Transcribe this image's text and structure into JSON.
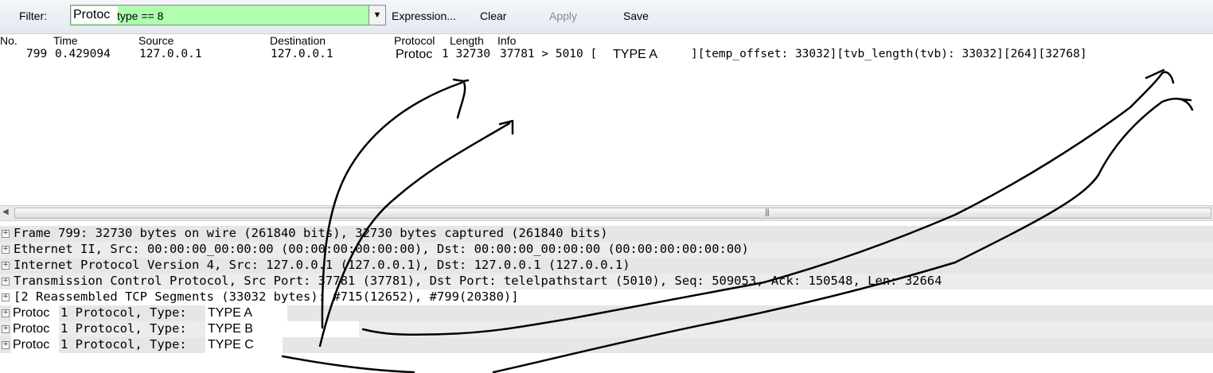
{
  "toolbar": {
    "filter_label": "Filter:",
    "filter_prefix": "Protoc",
    "filter_value": "type == 8",
    "expression_label": "Expression...",
    "clear_label": "Clear",
    "apply_label": "Apply",
    "save_label": "Save",
    "filter_bg_color": "#afffaf"
  },
  "packet_list": {
    "columns": [
      "No.",
      "Time",
      "Source",
      "Destination",
      "Protocol",
      "Length",
      "Info"
    ],
    "rows": [
      {
        "no": "799",
        "time": "0.429094",
        "source": "127.0.0.1",
        "destination": "127.0.0.1",
        "protocol": "Protoc",
        "length": "1 32730",
        "info_prefix": "37781 > 5010 [",
        "info_type": "TYPE A",
        "info_suffix": "][temp_offset: 33032][tvb_length(tvb): 33032][264][32768]"
      }
    ]
  },
  "details": [
    "Frame 799: 32730 bytes on wire (261840 bits), 32730 bytes captured (261840 bits)",
    "Ethernet II, Src: 00:00:00_00:00:00 (00:00:00:00:00:00), Dst: 00:00:00_00:00:00 (00:00:00:00:00:00)",
    "Internet Protocol Version 4, Src: 127.0.0.1 (127.0.0.1), Dst: 127.0.0.1 (127.0.0.1)",
    "Transmission Control Protocol, Src Port: 37781 (37781), Dst Port: telelpathstart (5010), Seq: 509053, Ack: 150548, Len: 32664",
    "[2 Reassembled TCP Segments (33032 bytes): #715(12652), #799(20380)]"
  ],
  "proto_rows": [
    {
      "prefix": "Protoc",
      "text": "1 Protocol, Type: ",
      "type": "TYPE A"
    },
    {
      "prefix": "Protoc",
      "text": "1 Protocol, Type: ",
      "type": "TYPE B"
    },
    {
      "prefix": "Protoc",
      "text": "1 Protocol, Type: ",
      "type": "TYPE C"
    }
  ],
  "icons": {
    "dropdown": "chevron-down-icon",
    "expander": "plus-expander-icon",
    "scroll_left": "arrow-left-icon",
    "scroll_grip": "grip-icon"
  }
}
